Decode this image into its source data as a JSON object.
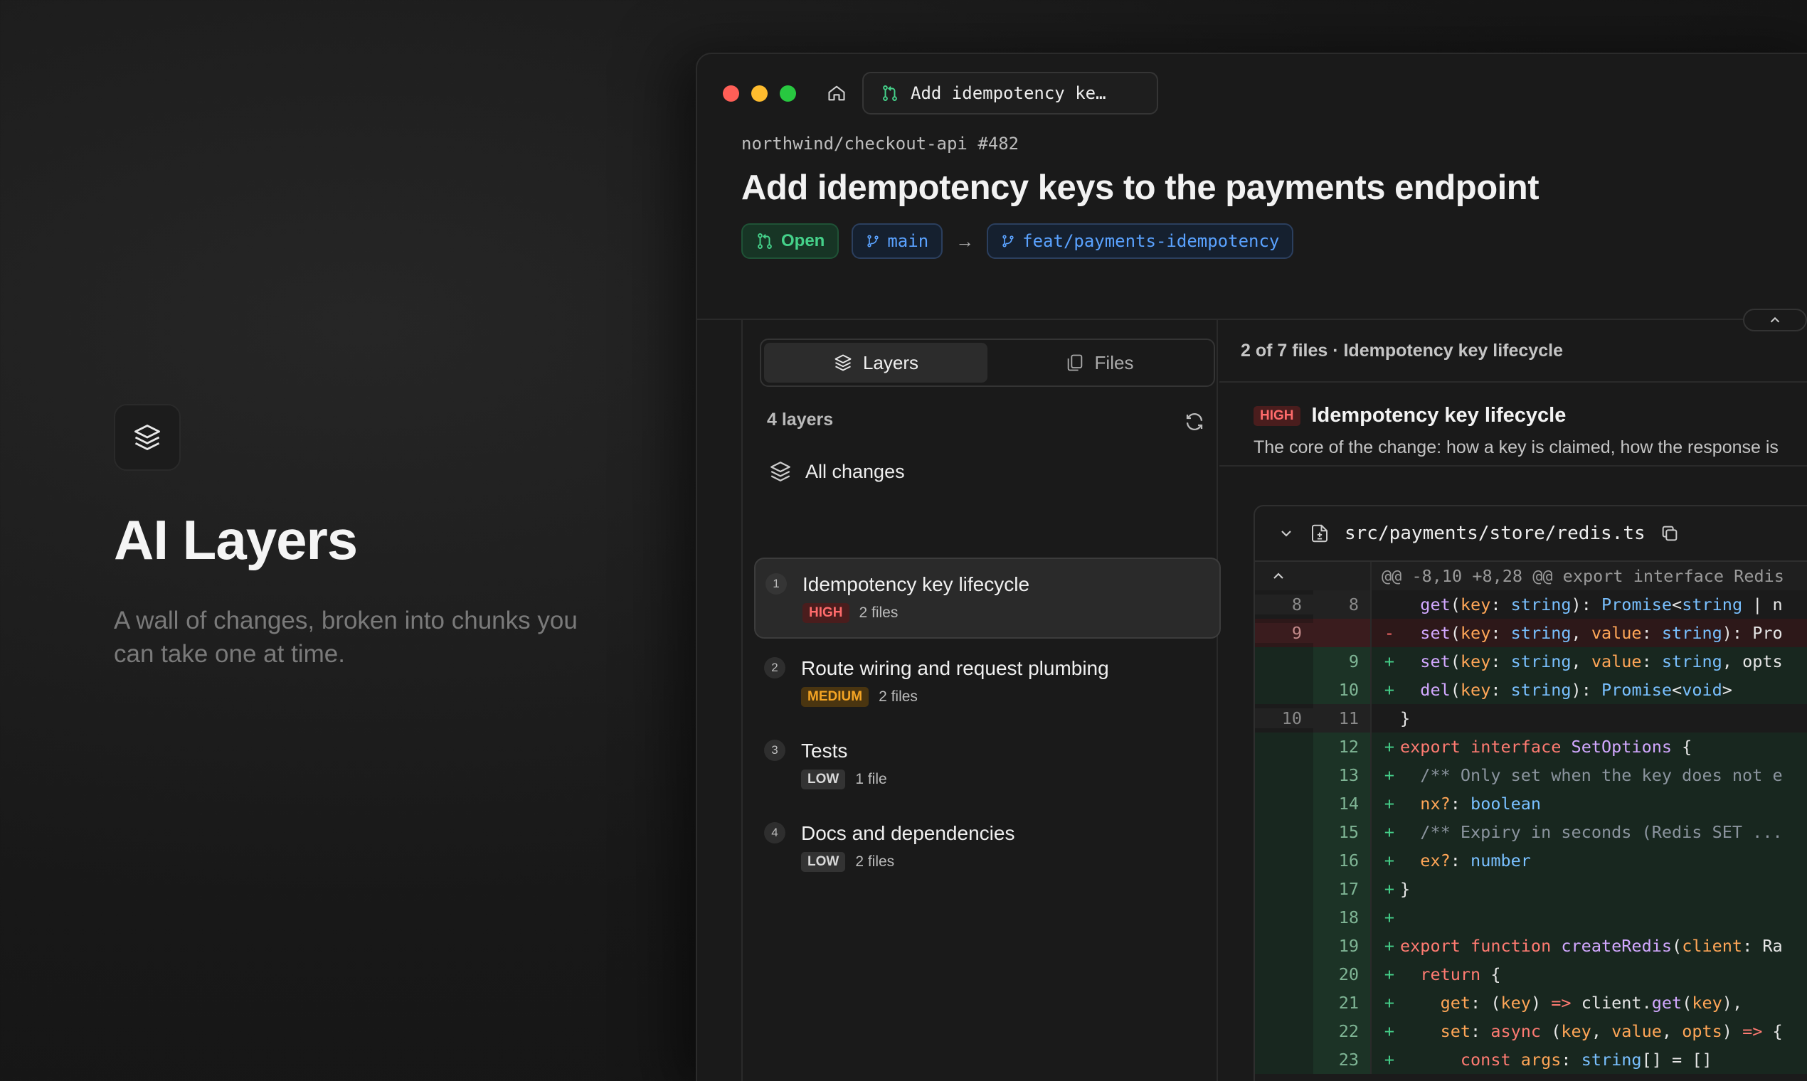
{
  "hero": {
    "icon": "layers-icon",
    "title": "AI Layers",
    "description": "A wall of changes, broken into chunks you can take one at time."
  },
  "window": {
    "traffic_lights": [
      "#ff5f57",
      "#febc2e",
      "#28c840"
    ],
    "tab_label": "Add idempotency ke…"
  },
  "pr": {
    "repo": "northwind/checkout-api #482",
    "title": "Add idempotency keys to the payments endpoint",
    "status": "Open",
    "base_branch": "main",
    "arrow": "→",
    "head_branch": "feat/payments-idempotency"
  },
  "sidebar": {
    "tabs": [
      {
        "label": "Layers",
        "icon": "layers-icon",
        "active": true
      },
      {
        "label": "Files",
        "icon": "files-icon",
        "active": false
      }
    ],
    "count_label": "4 layers",
    "all_changes": "All changes",
    "layers": [
      {
        "num": "1",
        "name": "Idempotency key lifecycle",
        "risk": "HIGH",
        "files": "2 files",
        "selected": true
      },
      {
        "num": "2",
        "name": "Route wiring and request plumbing",
        "risk": "MEDIUM",
        "files": "2 files",
        "selected": false
      },
      {
        "num": "3",
        "name": "Tests",
        "risk": "LOW",
        "files": "1 file",
        "selected": false
      },
      {
        "num": "4",
        "name": "Docs and dependencies",
        "risk": "LOW",
        "files": "2 files",
        "selected": false
      }
    ]
  },
  "detail": {
    "breadcrumb": "2 of 7 files · Idempotency key lifecycle",
    "risk": "HIGH",
    "title": "Idempotency key lifecycle",
    "description": "The core of the change: how a key is claimed, how the response is",
    "file_path": "src/payments/store/redis.ts",
    "hunk_header": "@@ -8,10 +8,28 @@ export interface Redis",
    "lines": [
      {
        "type": "ctx",
        "old": "8",
        "new": "8",
        "sign": "",
        "text": "  get(key: string): Promise<string | n"
      },
      {
        "type": "del",
        "old": "9",
        "new": "",
        "sign": "-",
        "text": "  set(key: string, value: string): Pro"
      },
      {
        "type": "add",
        "old": "",
        "new": "9",
        "sign": "+",
        "text": "  set(key: string, value: string, opts"
      },
      {
        "type": "add",
        "old": "",
        "new": "10",
        "sign": "+",
        "text": "  del(key: string): Promise<void>"
      },
      {
        "type": "ctx",
        "old": "10",
        "new": "11",
        "sign": "",
        "text": "}"
      },
      {
        "type": "add",
        "old": "",
        "new": "12",
        "sign": "+",
        "text": "export interface SetOptions {"
      },
      {
        "type": "add",
        "old": "",
        "new": "13",
        "sign": "+",
        "text": "  /** Only set when the key does not e"
      },
      {
        "type": "add",
        "old": "",
        "new": "14",
        "sign": "+",
        "text": "  nx?: boolean"
      },
      {
        "type": "add",
        "old": "",
        "new": "15",
        "sign": "+",
        "text": "  /** Expiry in seconds (Redis SET ..."
      },
      {
        "type": "add",
        "old": "",
        "new": "16",
        "sign": "+",
        "text": "  ex?: number"
      },
      {
        "type": "add",
        "old": "",
        "new": "17",
        "sign": "+",
        "text": "}"
      },
      {
        "type": "add",
        "old": "",
        "new": "18",
        "sign": "+",
        "text": ""
      },
      {
        "type": "add",
        "old": "",
        "new": "19",
        "sign": "+",
        "text": "export function createRedis(client: Ra"
      },
      {
        "type": "add",
        "old": "",
        "new": "20",
        "sign": "+",
        "text": "  return {"
      },
      {
        "type": "add",
        "old": "",
        "new": "21",
        "sign": "+",
        "text": "    get: (key) => client.get(key),"
      },
      {
        "type": "add",
        "old": "",
        "new": "22",
        "sign": "+",
        "text": "    set: async (key, value, opts) => {"
      },
      {
        "type": "add",
        "old": "",
        "new": "23",
        "sign": "+",
        "text": "      const args: string[] = []"
      }
    ]
  },
  "colors": {
    "accent_green": "#45d18a",
    "accent_blue": "#5aa2ff",
    "high": "#ff6b6b",
    "medium": "#f5a524"
  }
}
